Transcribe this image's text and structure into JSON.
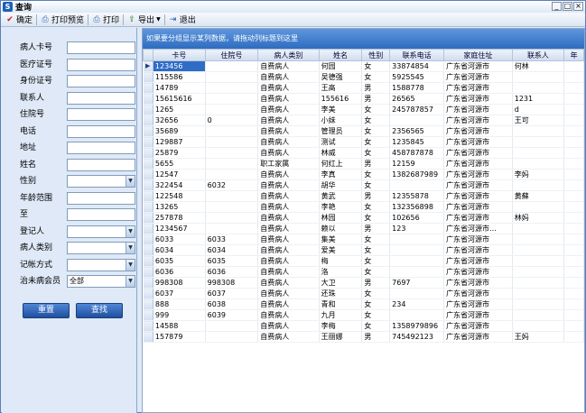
{
  "window": {
    "title": "查询",
    "app_icon": "S",
    "controls": [
      "_",
      "□",
      "×"
    ]
  },
  "toolbar": {
    "items": [
      {
        "label": "确定",
        "icon": "check-icon"
      },
      {
        "label": "打印预览",
        "icon": "print-preview-icon"
      },
      {
        "label": "打印",
        "icon": "printer-icon"
      },
      {
        "label": "导出",
        "icon": "export-icon"
      },
      {
        "label": "退出",
        "icon": "exit-icon"
      }
    ]
  },
  "form": {
    "fields": [
      {
        "label": "病人卡号",
        "value": "",
        "type": "text"
      },
      {
        "label": "医疗证号",
        "value": "",
        "type": "text"
      },
      {
        "label": "身份证号",
        "value": "",
        "type": "text"
      },
      {
        "label": "联系人",
        "value": "",
        "type": "text"
      },
      {
        "label": "住院号",
        "value": "",
        "type": "text"
      },
      {
        "label": "电话",
        "value": "",
        "type": "text"
      },
      {
        "label": "地址",
        "value": "",
        "type": "text"
      },
      {
        "label": "姓名",
        "value": "",
        "type": "text"
      },
      {
        "label": "性别",
        "value": "",
        "type": "select"
      },
      {
        "label": "年龄范围",
        "value": "",
        "type": "text"
      },
      {
        "label": "至",
        "value": "",
        "type": "text"
      },
      {
        "label": "登记人",
        "value": "",
        "type": "select"
      },
      {
        "label": "病人类别",
        "value": "",
        "type": "select"
      },
      {
        "label": "记帐方式",
        "value": "",
        "type": "select"
      },
      {
        "label": "治未病会员",
        "value": "全部",
        "type": "select"
      }
    ],
    "reset_label": "重置",
    "search_label": "查找"
  },
  "grid": {
    "group_hint": "如果要分组显示某列数据，请拖动列标题到这里",
    "columns": [
      "卡号",
      "住院号",
      "病人类别",
      "姓名",
      "性别",
      "联系电话",
      "家庭住址",
      "联系人",
      "年"
    ],
    "rows": [
      [
        "123456",
        "",
        "自费病人",
        "何园",
        "女",
        "33874854",
        "广东省河源市",
        "何林",
        ""
      ],
      [
        "115586",
        "",
        "自费病人",
        "吴德强",
        "女",
        "5925545",
        "广东省河源市",
        "",
        ""
      ],
      [
        "14789",
        "",
        "自费病人",
        "王高",
        "男",
        "1588778",
        "广东省河源市",
        "",
        ""
      ],
      [
        "15615616",
        "",
        "自费病人",
        "155616",
        "男",
        "26565",
        "广东省河源市",
        "1231",
        ""
      ],
      [
        "1265",
        "",
        "自费病人",
        "李美",
        "女",
        "245787857",
        "广东省河源市",
        "d",
        ""
      ],
      [
        "32656",
        "0",
        "自费病人",
        "小妹",
        "女",
        "",
        "广东省河源市",
        "王可",
        ""
      ],
      [
        "35689",
        "",
        "自费病人",
        "管理员",
        "女",
        "2356565",
        "广东省河源市",
        "",
        ""
      ],
      [
        "129887",
        "",
        "自费病人",
        "测试",
        "女",
        "1235845",
        "广东省河源市",
        "",
        ""
      ],
      [
        "25879",
        "",
        "自费病人",
        "林威",
        "女",
        "458787878",
        "广东省河源市",
        "",
        ""
      ],
      [
        "5655",
        "",
        "职工家属",
        "何红上",
        "男",
        "12159",
        "广东省河源市",
        "",
        ""
      ],
      [
        "12547",
        "",
        "自费病人",
        "李真",
        "女",
        "1382687989",
        "广东省河源市",
        "李妈",
        ""
      ],
      [
        "322454",
        "6032",
        "自费病人",
        "胡华",
        "女",
        "",
        "广东省河源市",
        "",
        ""
      ],
      [
        "122548",
        "",
        "自费病人",
        "黄武",
        "男",
        "12355878",
        "广东省河源市",
        "黄蘇",
        ""
      ],
      [
        "13265",
        "",
        "自费病人",
        "李艳",
        "女",
        "132356898",
        "广东省河源市",
        "",
        ""
      ],
      [
        "257878",
        "",
        "自费病人",
        "林园",
        "女",
        "102656",
        "广东省河源市",
        "林妈",
        ""
      ],
      [
        "1234567",
        "",
        "自费病人",
        "赖以",
        "男",
        "123",
        "广东省河源市...",
        "",
        ""
      ],
      [
        "6033",
        "6033",
        "自费病人",
        "集美",
        "女",
        "",
        "广东省河源市",
        "",
        ""
      ],
      [
        "6034",
        "6034",
        "自费病人",
        "爱美",
        "女",
        "",
        "广东省河源市",
        "",
        ""
      ],
      [
        "6035",
        "6035",
        "自费病人",
        "梅",
        "女",
        "",
        "广东省河源市",
        "",
        ""
      ],
      [
        "6036",
        "6036",
        "自费病人",
        "洛",
        "女",
        "",
        "广东省河源市",
        "",
        ""
      ],
      [
        "998308",
        "998308",
        "自费病人",
        "大卫",
        "男",
        "7697",
        "广东省河源市",
        "",
        ""
      ],
      [
        "6037",
        "6037",
        "自费病人",
        "还珠",
        "女",
        "",
        "广东省河源市",
        "",
        ""
      ],
      [
        "888",
        "6038",
        "自费病人",
        "青和",
        "女",
        "234",
        "广东省河源市",
        "",
        ""
      ],
      [
        "999",
        "6039",
        "自费病人",
        "九月",
        "女",
        "",
        "广东省河源市",
        "",
        ""
      ],
      [
        "14588",
        "",
        "自费病人",
        "李梅",
        "女",
        "1358979896",
        "广东省河源市",
        "",
        ""
      ],
      [
        "157879",
        "",
        "自费病人",
        "王丽娜",
        "男",
        "745492123",
        "广东省河源市",
        "王妈",
        ""
      ]
    ],
    "selected_row": 0
  }
}
